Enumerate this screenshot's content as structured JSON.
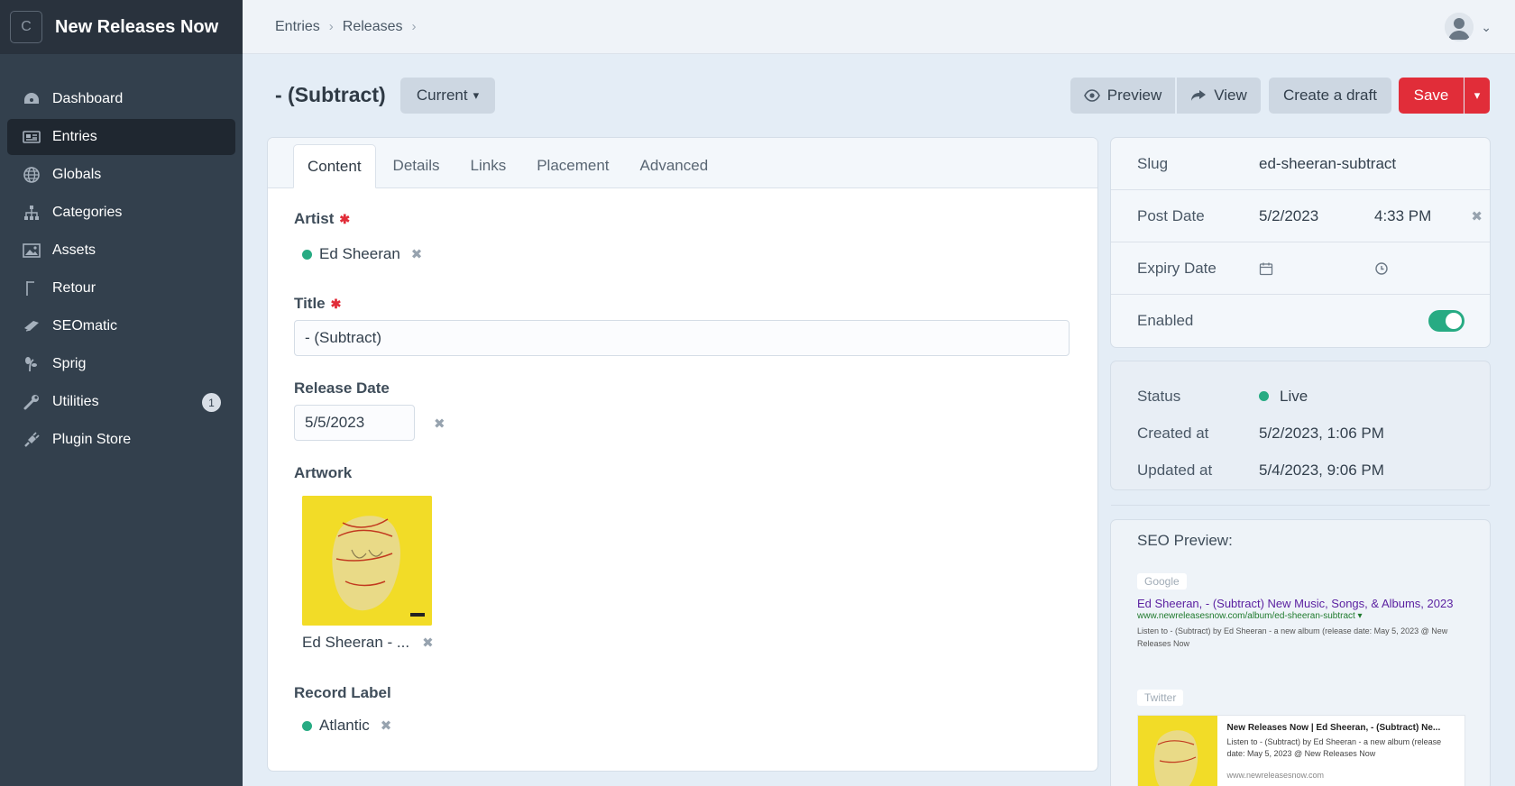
{
  "site": {
    "logo_letter": "C",
    "name": "New Releases Now"
  },
  "nav": [
    {
      "label": "Dashboard",
      "icon": "dashboard-icon"
    },
    {
      "label": "Entries",
      "icon": "entries-icon",
      "active": true
    },
    {
      "label": "Globals",
      "icon": "globe-icon"
    },
    {
      "label": "Categories",
      "icon": "sitemap-icon"
    },
    {
      "label": "Assets",
      "icon": "image-icon"
    },
    {
      "label": "Retour",
      "icon": "flag-icon"
    },
    {
      "label": "SEOmatic",
      "icon": "seomatic-icon"
    },
    {
      "label": "Sprig",
      "icon": "sprig-icon"
    },
    {
      "label": "Utilities",
      "icon": "wrench-icon",
      "badge": "1"
    },
    {
      "label": "Plugin Store",
      "icon": "plug-icon"
    }
  ],
  "breadcrumbs": [
    "Entries",
    "Releases"
  ],
  "page": {
    "title": "- (Subtract)",
    "revision": "Current"
  },
  "actions": {
    "preview": "Preview",
    "view": "View",
    "draft": "Create a draft",
    "save": "Save"
  },
  "tabs": [
    "Content",
    "Details",
    "Links",
    "Placement",
    "Advanced"
  ],
  "fields": {
    "artist_label": "Artist",
    "artist_value": "Ed Sheeran",
    "title_label": "Title",
    "title_value": "- (Subtract)",
    "release_label": "Release Date",
    "release_value": "5/5/2023",
    "artwork_label": "Artwork",
    "artwork_caption": "Ed Sheeran - ...",
    "label_label": "Record Label",
    "label_value": "Atlantic"
  },
  "meta": {
    "slug_label": "Slug",
    "slug_value": "ed-sheeran-subtract",
    "post_label": "Post Date",
    "post_date": "5/2/2023",
    "post_time": "4:33 PM",
    "expiry_label": "Expiry Date",
    "enabled_label": "Enabled"
  },
  "status": {
    "status_label": "Status",
    "status_value": "Live",
    "created_label": "Created at",
    "created_value": "5/2/2023, 1:06 PM",
    "updated_label": "Updated at",
    "updated_value": "5/4/2023, 9:06 PM"
  },
  "seo": {
    "title": "SEO Preview:",
    "google_tag": "Google",
    "google_title": "Ed Sheeran, - (Subtract) New Music, Songs, & Albums, 2023",
    "google_url": "www.newreleasesnow.com/album/ed-sheeran-subtract ▾",
    "google_desc": "Listen to - (Subtract) by Ed Sheeran - a new album (release date: May 5, 2023 @ New Releases Now",
    "twitter_tag": "Twitter",
    "twitter_title": "New Releases Now | Ed Sheeran, - (Subtract) Ne...",
    "twitter_desc": "Listen to - (Subtract) by Ed Sheeran - a new album (release date: May 5, 2023 @ New Releases Now",
    "twitter_url": "www.newreleasesnow.com"
  },
  "colors": {
    "sidebar": "#33404d",
    "accent_red": "#e12d39",
    "live_green": "#27ab83"
  }
}
